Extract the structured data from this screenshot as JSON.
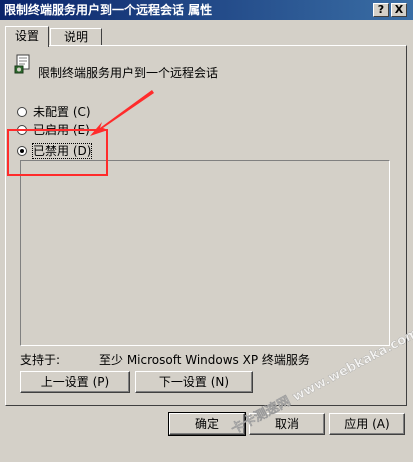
{
  "window": {
    "title": "限制终端服务用户到一个远程会话 属性",
    "help_btn": "?",
    "close_btn": "X"
  },
  "tabs": [
    {
      "label": "设置",
      "active": true
    },
    {
      "label": "说明",
      "active": false
    }
  ],
  "policy": {
    "icon": "policy-setting-icon",
    "name": "限制终端服务用户到一个远程会话"
  },
  "options": [
    {
      "label": "未配置 (C)",
      "checked": false
    },
    {
      "label": "已启用 (E)",
      "checked": false
    },
    {
      "label": "已禁用 (D)",
      "checked": true
    }
  ],
  "supported": {
    "label": "支持于:",
    "value": "至少 Microsoft Windows XP 终端服务"
  },
  "nav_buttons": {
    "prev": "上一设置 (P)",
    "next": "下一设置 (N)"
  },
  "dialog_buttons": {
    "ok": "确定",
    "cancel": "取消",
    "apply": "应用 (A)"
  },
  "annotation": {
    "color": "#ff2b2b"
  },
  "watermark": {
    "text": "卡卡测速网 www.webkaka.com"
  }
}
